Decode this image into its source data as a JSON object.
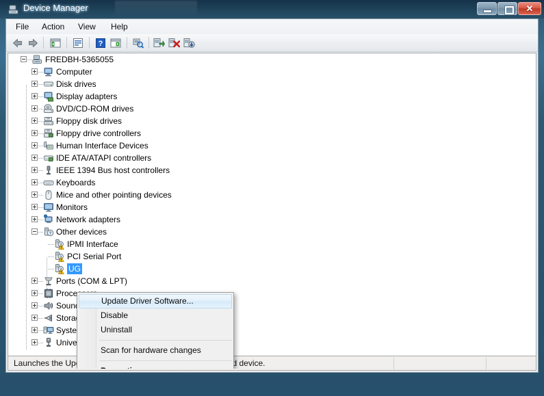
{
  "window": {
    "title": "Device Manager",
    "icon": "device-manager-icon",
    "caption_buttons": {
      "minimize": "Minimize",
      "maximize": "Maximize",
      "close": "Close"
    }
  },
  "menubar": {
    "items": [
      {
        "label": "File",
        "name": "menu-file"
      },
      {
        "label": "Action",
        "name": "menu-action"
      },
      {
        "label": "View",
        "name": "menu-view"
      },
      {
        "label": "Help",
        "name": "menu-help"
      }
    ]
  },
  "toolbar": {
    "items": [
      {
        "name": "back-icon",
        "tooltip": "Back"
      },
      {
        "name": "forward-icon",
        "tooltip": "Forward"
      },
      {
        "name": "show-console-tree-icon",
        "tooltip": "Show/Hide Console Tree"
      },
      {
        "name": "properties-icon",
        "tooltip": "Properties"
      },
      {
        "name": "help-icon",
        "tooltip": "Help"
      },
      {
        "name": "show-hidden-devices-icon",
        "tooltip": "Show hidden devices"
      },
      {
        "name": "scan-for-hardware-changes-icon",
        "tooltip": "Scan for hardware changes"
      },
      {
        "name": "update-driver-software-icon",
        "tooltip": "Update Driver Software"
      },
      {
        "name": "uninstall-icon",
        "tooltip": "Uninstall"
      },
      {
        "name": "disable-icon",
        "tooltip": "Disable"
      }
    ]
  },
  "tree": {
    "nodes": [
      {
        "label": "FREDBH-5365055",
        "depth": 0,
        "state": "expanded",
        "icon": "computer-root-icon"
      },
      {
        "label": "Computer",
        "depth": 1,
        "state": "collapsed",
        "icon": "computer-icon"
      },
      {
        "label": "Disk drives",
        "depth": 1,
        "state": "collapsed",
        "icon": "disk-drive-icon"
      },
      {
        "label": "Display adapters",
        "depth": 1,
        "state": "collapsed",
        "icon": "display-adapter-icon"
      },
      {
        "label": "DVD/CD-ROM drives",
        "depth": 1,
        "state": "collapsed",
        "icon": "dvd-drive-icon"
      },
      {
        "label": "Floppy disk drives",
        "depth": 1,
        "state": "collapsed",
        "icon": "floppy-disk-icon"
      },
      {
        "label": "Floppy drive controllers",
        "depth": 1,
        "state": "collapsed",
        "icon": "floppy-controller-icon"
      },
      {
        "label": "Human Interface Devices",
        "depth": 1,
        "state": "collapsed",
        "icon": "hid-icon"
      },
      {
        "label": "IDE ATA/ATAPI controllers",
        "depth": 1,
        "state": "collapsed",
        "icon": "ide-controller-icon"
      },
      {
        "label": "IEEE 1394 Bus host controllers",
        "depth": 1,
        "state": "collapsed",
        "icon": "ieee1394-icon"
      },
      {
        "label": "Keyboards",
        "depth": 1,
        "state": "collapsed",
        "icon": "keyboard-icon"
      },
      {
        "label": "Mice and other pointing devices",
        "depth": 1,
        "state": "collapsed",
        "icon": "mouse-icon"
      },
      {
        "label": "Monitors",
        "depth": 1,
        "state": "collapsed",
        "icon": "monitor-icon"
      },
      {
        "label": "Network adapters",
        "depth": 1,
        "state": "collapsed",
        "icon": "network-adapter-icon"
      },
      {
        "label": "Other devices",
        "depth": 1,
        "state": "expanded",
        "icon": "other-devices-icon"
      },
      {
        "label": "IPMI Interface",
        "depth": 2,
        "state": "leaf",
        "icon": "unknown-device-warning-icon"
      },
      {
        "label": "PCI Serial Port",
        "depth": 2,
        "state": "leaf",
        "icon": "unknown-device-warning-icon"
      },
      {
        "label": "UG",
        "depth": 2,
        "state": "leaf",
        "icon": "unknown-device-warning-icon",
        "selected": true
      },
      {
        "label": "Ports (COM & LPT)",
        "depth": 1,
        "state": "collapsed",
        "icon": "ports-icon"
      },
      {
        "label": "Processors",
        "depth": 1,
        "state": "collapsed",
        "icon": "processor-icon"
      },
      {
        "label": "Sound, video and game controllers",
        "depth": 1,
        "state": "collapsed",
        "icon": "sound-icon"
      },
      {
        "label": "Storage controllers",
        "depth": 1,
        "state": "collapsed",
        "icon": "storage-controller-icon"
      },
      {
        "label": "System devices",
        "depth": 1,
        "state": "collapsed",
        "icon": "system-device-icon"
      },
      {
        "label": "Universal Serial Bus controllers",
        "depth": 1,
        "state": "collapsed",
        "icon": "usb-icon"
      }
    ]
  },
  "context_menu": {
    "items": [
      {
        "label": "Update Driver Software...",
        "type": "item",
        "highlighted": true,
        "bold": false
      },
      {
        "label": "Disable",
        "type": "item",
        "highlighted": false,
        "bold": false
      },
      {
        "label": "Uninstall",
        "type": "item",
        "highlighted": false,
        "bold": false
      },
      {
        "type": "separator"
      },
      {
        "label": "Scan for hardware changes",
        "type": "item",
        "highlighted": false,
        "bold": false
      },
      {
        "type": "separator"
      },
      {
        "label": "Properties",
        "type": "item",
        "highlighted": false,
        "bold": true
      }
    ]
  },
  "statusbar": {
    "message": "Launches the Update Driver Software Wizard for the selected device.",
    "pane2": "",
    "pane3": ""
  },
  "colors": {
    "selection_blue": "#3399ff",
    "titlebar_dark": "#1c3f56",
    "close_red": "#d75a48",
    "warning_yellow": "#ffcc33",
    "client_gray": "#f0f0f0"
  }
}
